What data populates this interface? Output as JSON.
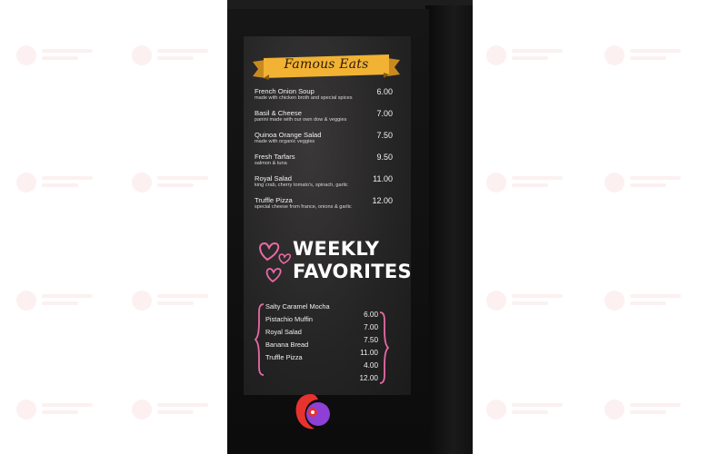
{
  "menu": {
    "title": "Famous Eats",
    "items": [
      {
        "name": "French Onion Soup",
        "desc": "made with chicken broth and special spices",
        "price": "6.00"
      },
      {
        "name": "Basil & Cheese",
        "desc": "panini made with our own dow & veggies",
        "price": "7.00"
      },
      {
        "name": "Quinoa Orange Salad",
        "desc": "made with organic veggies",
        "price": "7.50"
      },
      {
        "name": "Fresh Tarfars",
        "desc": "salmon & tuna",
        "price": "9.50"
      },
      {
        "name": "Royal Salad",
        "desc": "king crab, cherry tomato's, spinach, garlic",
        "price": "11.00"
      },
      {
        "name": "Truffle Pizza",
        "desc": "special cheese from france, onions & garlic",
        "price": "12.00"
      }
    ]
  },
  "weekly": {
    "line1": "WEEKLY",
    "line2": "FAVORITES",
    "items": [
      "Salty Caramel Mocha",
      "Pistachio Muffin",
      "Royal Salad",
      "Banana Bread",
      "Truffle Pizza"
    ],
    "prices": [
      "6.00",
      "7.00",
      "7.50",
      "11.00",
      "4.00",
      "12.00"
    ]
  },
  "colors": {
    "banner_gold": "#f2b233",
    "heart_pink": "#e86aa6",
    "logo_red": "#e8322e",
    "logo_purple": "#8e3fd6"
  }
}
